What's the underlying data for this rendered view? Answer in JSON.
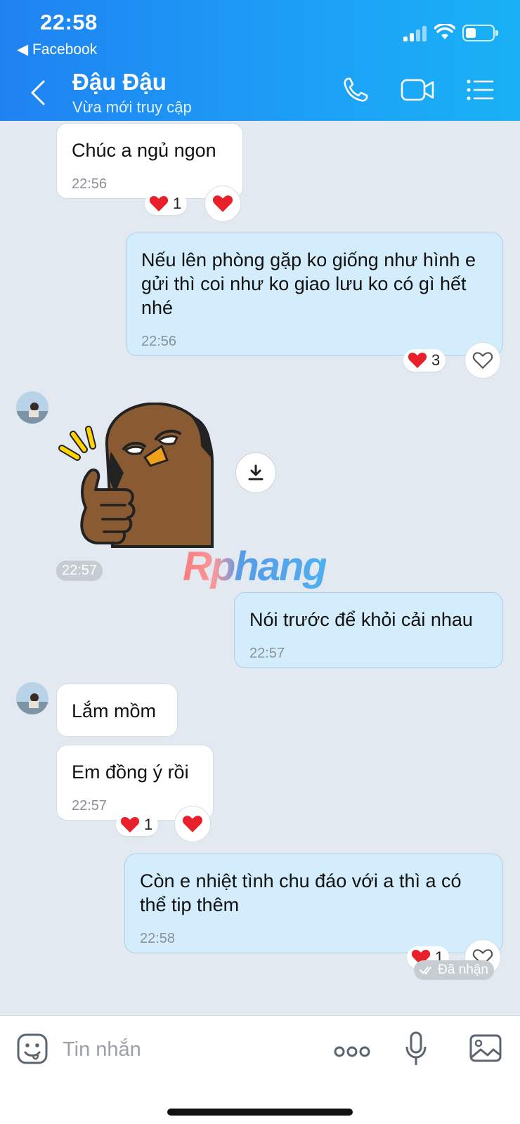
{
  "status_bar": {
    "time": "22:58",
    "back_app": "◀ Facebook"
  },
  "header": {
    "name": "Đậu Đậu",
    "status": "Vừa mới truy cập"
  },
  "messages": [
    {
      "text": "Chúc a ngủ ngon",
      "time": "22:56",
      "reaction_count": "1"
    },
    {
      "text": "Nếu lên phòng gặp ko giống như hình e gửi thì coi như ko giao lưu ko có gì hết nhé",
      "time": "22:56",
      "reaction_count": "3"
    },
    {
      "time": "22:57"
    },
    {
      "text": "Nói trước để khỏi cải nhau",
      "time": "22:57"
    },
    {
      "text": "Lắm mồm"
    },
    {
      "text": "Em đồng ý rồi",
      "time": "22:57",
      "reaction_count": "1"
    },
    {
      "text": "Còn e nhiệt tình chu đáo với a thì a có thể tip thêm",
      "time": "22:58",
      "reaction_count": "1"
    }
  ],
  "received_label": "Đã nhận",
  "watermark": "Rphang",
  "composer": {
    "placeholder": "Tin nhắn"
  },
  "colors": {
    "header": "#1f82f2",
    "outgoing": "#d4edfc",
    "incoming": "#ffffff",
    "heart": "#e8202c"
  }
}
